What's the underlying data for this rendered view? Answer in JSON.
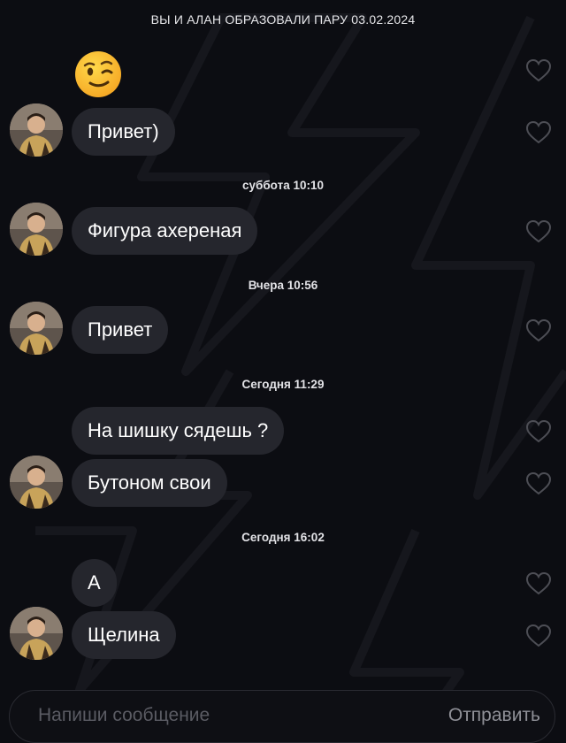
{
  "header": {
    "pair_note": "ВЫ И АЛАН ОБРАЗОВАЛИ ПАРУ 03.02.2024"
  },
  "separators": [
    "суббота 10:10",
    "Вчера 10:56",
    "Сегодня 11:29",
    "Сегодня 16:02"
  ],
  "messages": [
    {
      "type": "emoji",
      "emoji": "winking-face"
    },
    {
      "text": "Привет)"
    },
    {
      "text": "Фигура ахереная"
    },
    {
      "text": "Привет"
    },
    {
      "text": "На шишку сядешь ?"
    },
    {
      "text": "Бутоном свои"
    },
    {
      "text": "А"
    },
    {
      "text": "Щелина"
    }
  ],
  "composer": {
    "placeholder": "Напиши сообщение",
    "send_label": "Отправить"
  },
  "icons": {
    "like": "heart-outline-icon",
    "avatar": "avatar-photo"
  },
  "colors": {
    "background": "#0c0d12",
    "bubble": "#25262d",
    "heart": "#4d4e55"
  }
}
